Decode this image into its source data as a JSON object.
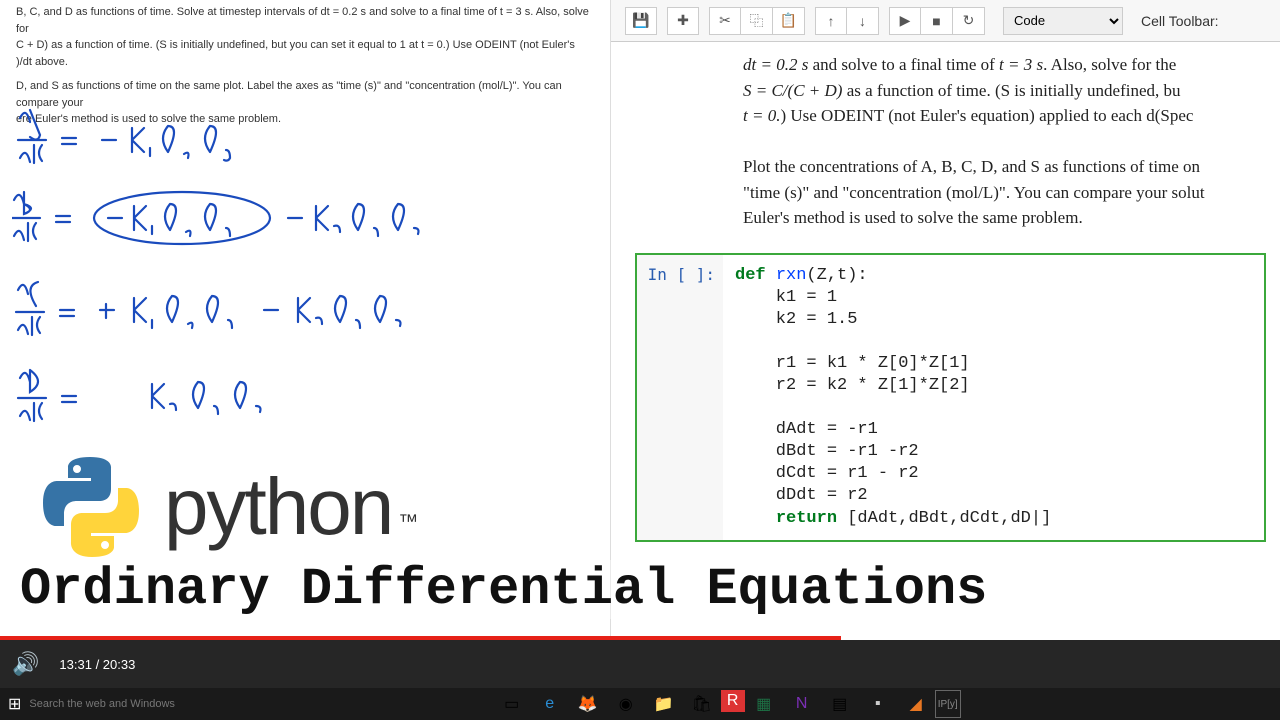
{
  "left": {
    "problem_line1": "B, C, and D as functions of time. Solve at timestep intervals of dt = 0.2 s and solve to a final time of t = 3 s. Also, solve for",
    "problem_line2": "C + D) as a function of time. (S is initially undefined, but you can set it equal to 1 at t = 0.) Use ODEINT (not Euler's",
    "problem_line3": ")/dt above.",
    "problem_line4": "D, and S as functions of time on the same plot. Label the axes as \"time (s)\" and \"concentration (mol/L)\". You can compare your",
    "problem_line5": "ere Euler's method is used to solve the same problem.",
    "python_word": "python",
    "python_tm": "™",
    "subtitle": "Ordinary Differential Equations"
  },
  "toolbar": {
    "save": "💾",
    "add": "✚",
    "cut": "✂",
    "copy": "⿻",
    "paste": "📋",
    "up": "↑",
    "down": "↓",
    "run": "▶",
    "stop": "■",
    "restart": "↻",
    "celltype": "Code",
    "celltoolbar": "Cell Toolbar:"
  },
  "markdown": {
    "l1_a": "dt = 0.2 s",
    "l1_b": " and solve to a final time of ",
    "l1_c": "t = 3 s",
    "l1_d": ". Also, solve for the ",
    "l2_a": "S = C/(C + D)",
    "l2_b": " as a function of time. (S is initially undefined, bu",
    "l3_a": "t = 0.",
    "l3_b": ") Use ODEINT (not Euler's equation) applied to each d(Spec",
    "p2_a": "Plot the concentrations of A, B, C, D, and S as functions of time on",
    "p2_b": "\"time (s)\" and \"concentration (mol/L)\". You can compare your solut",
    "p2_c": "Euler's method is used to solve the same problem."
  },
  "code": {
    "prompt": "In [ ]:",
    "def": "def",
    "fn": "rxn",
    "sig": "(Z,t):",
    "l2": "    k1 = 1",
    "l3": "    k2 = 1.5",
    "l4": "",
    "l5": "    r1 = k1 * Z[0]*Z[1]",
    "l6": "    r2 = k2 * Z[1]*Z[2]",
    "l7": "",
    "l8": "    dAdt = -r1",
    "l9": "    dBdt = -r1 -r2",
    "l10": "    dCdt = r1 - r2",
    "l11": "    dDdt = r2",
    "ret": "return",
    "l12": " [dAdt,dBdt,dCdt,dD|]"
  },
  "video": {
    "current": "13:31",
    "sep": " / ",
    "total": "20:33"
  },
  "taskbar": {
    "search_placeholder": "Search the web and Windows"
  }
}
